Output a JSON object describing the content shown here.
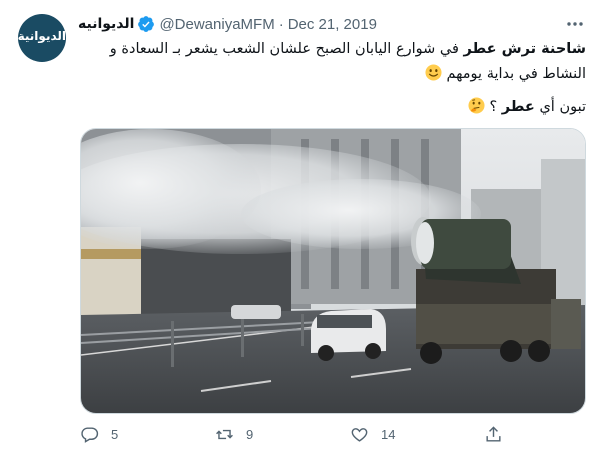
{
  "tweet": {
    "avatar_text": "الديوانية",
    "display_name": "الديوانيه",
    "handle": "@DewaniyaMFM",
    "separator": "·",
    "date": "Dec 21, 2019",
    "text_bold": "شاحنة ترش عطر",
    "text_rest": " في شوارع اليابان الصبح علشان الشعب يشعر بـ السعادة و النشاط في بداية يومهم",
    "second_line_prefix": "تبون أي ",
    "second_line_bold": "عطر",
    "second_line_suffix": " ؟",
    "emoji_1": "slightly-smiling-face",
    "emoji_2": "thinking-face"
  },
  "actions": {
    "replies": "5",
    "retweets": "9",
    "likes": "14"
  },
  "colors": {
    "verified_blue": "#1d9bf0",
    "secondary_text": "#536471",
    "avatar_bg": "#1a4b63"
  }
}
